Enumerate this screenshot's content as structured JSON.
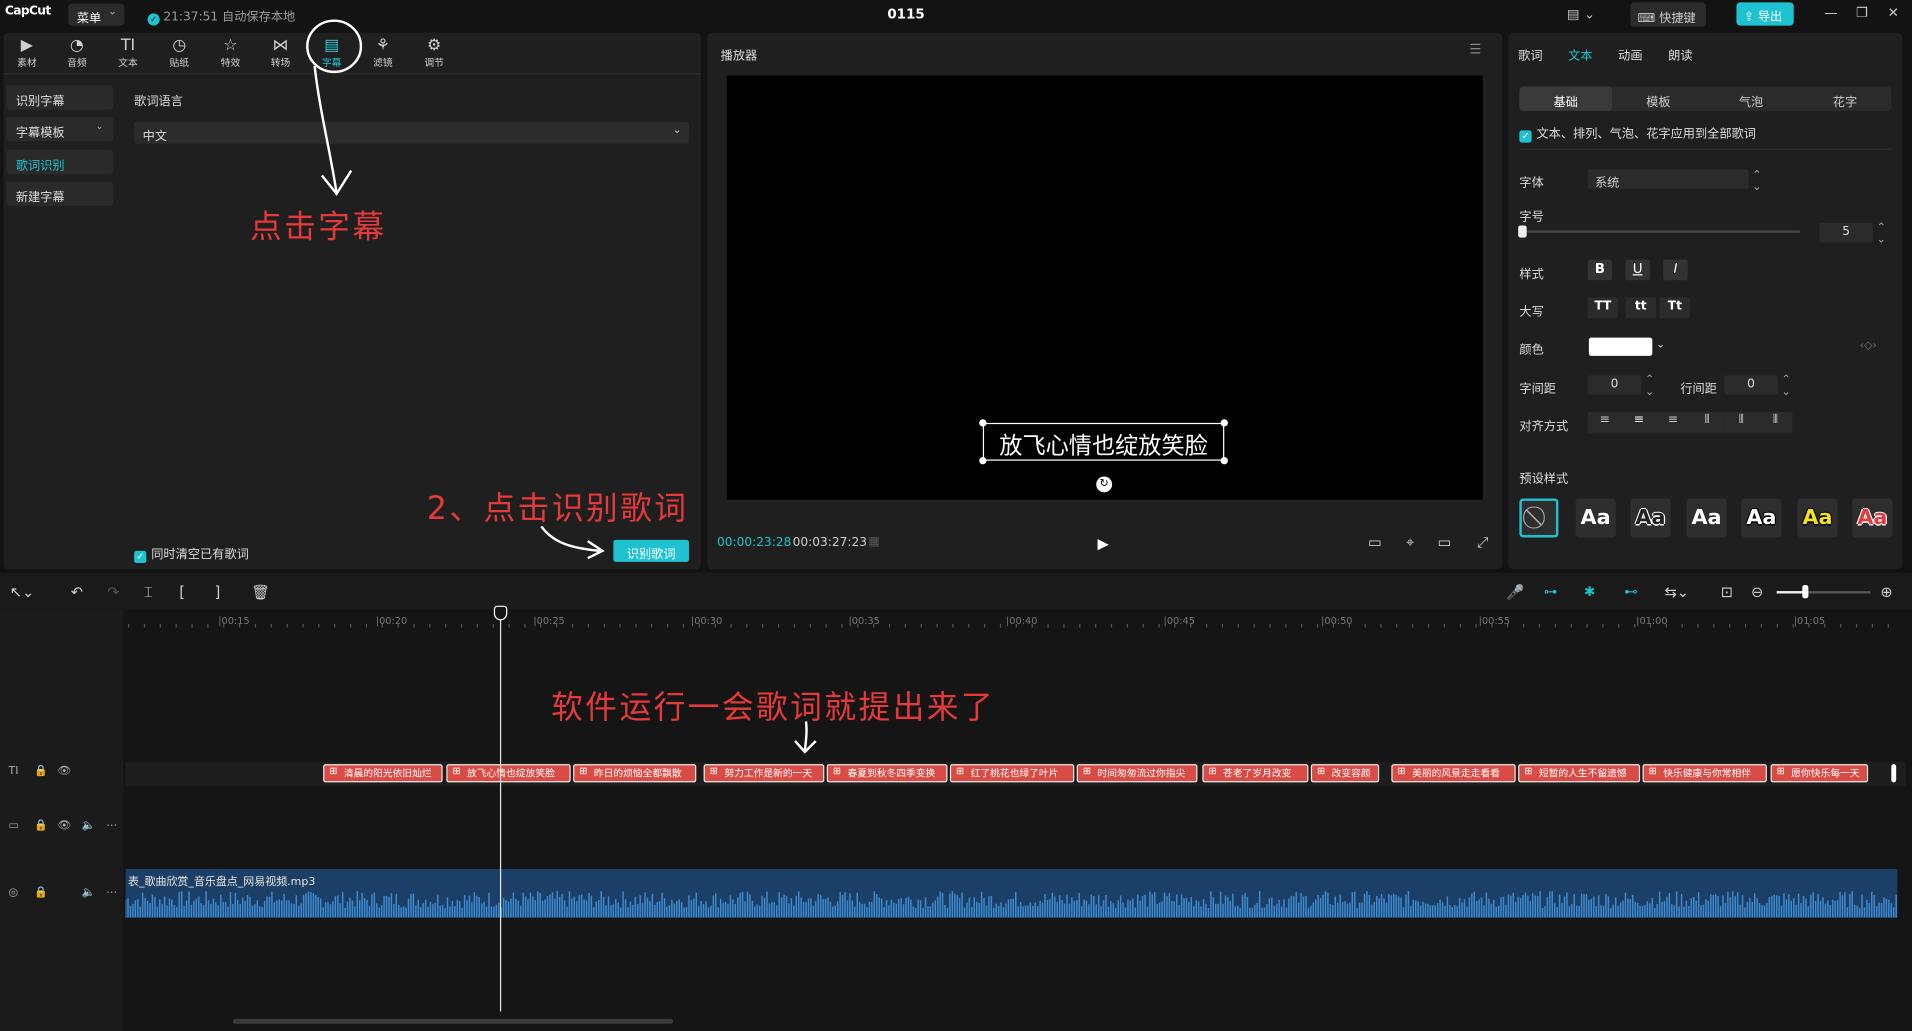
{
  "app": {
    "logo": "CapCut",
    "menu_label": "菜单",
    "save_status": "21:37:51 自动保存本地",
    "project_title": "0115",
    "shortcut_label": "快捷键",
    "export_label": "导出"
  },
  "media_tools": [
    {
      "label": "素材",
      "icon": "media-icon"
    },
    {
      "label": "音频",
      "icon": "audio-icon"
    },
    {
      "label": "文本",
      "icon": "text-icon"
    },
    {
      "label": "贴纸",
      "icon": "sticker-icon"
    },
    {
      "label": "特效",
      "icon": "effects-icon"
    },
    {
      "label": "转场",
      "icon": "transition-icon"
    },
    {
      "label": "字幕",
      "icon": "captions-icon",
      "active": true
    },
    {
      "label": "滤镜",
      "icon": "filter-icon"
    },
    {
      "label": "调节",
      "icon": "adjust-icon"
    }
  ],
  "caption_nav": [
    {
      "label": "识别字幕"
    },
    {
      "label": "字幕模板"
    },
    {
      "label": "歌词识别",
      "active": true
    },
    {
      "label": "新建字幕"
    }
  ],
  "lyrics_panel": {
    "language_label": "歌词语言",
    "language_value": "中文",
    "clear_existing_label": "同时清空已有歌词",
    "recognize_button": "识别歌词"
  },
  "player": {
    "title": "播放器",
    "caption_text": "放飞心情也绽放笑脸",
    "current_time": "00:00:23:28",
    "total_time": "00:03:27:23"
  },
  "properties": {
    "tabs": [
      {
        "label": "歌词"
      },
      {
        "label": "文本",
        "active": true
      },
      {
        "label": "动画"
      },
      {
        "label": "朗读"
      }
    ],
    "segments": [
      {
        "label": "基础",
        "active": true
      },
      {
        "label": "模板"
      },
      {
        "label": "气泡"
      },
      {
        "label": "花字"
      }
    ],
    "apply_all_label": "文本、排列、气泡、花字应用到全部歌词",
    "font_label": "字体",
    "font_value": "系统",
    "size_label": "字号",
    "size_value": "5",
    "style_label": "样式",
    "case_label": "大写",
    "case_buttons": [
      "TT",
      "tt",
      "Tt"
    ],
    "color_label": "颜色",
    "color_value": "#ffffff",
    "char_spacing_label": "字间距",
    "char_spacing_value": "0",
    "line_spacing_label": "行间距",
    "line_spacing_value": "0",
    "align_label": "对齐方式",
    "preset_label": "预设样式",
    "preset_text": "Aa",
    "presets": [
      {
        "color": "#ffffff",
        "outline": "none"
      },
      {
        "color": "#222222",
        "outline": "#ffffff"
      },
      {
        "color": "#ffffff",
        "outline": "none"
      },
      {
        "color": "#ffffff",
        "outline": "#000000"
      },
      {
        "color": "#f5e11a",
        "outline": "#000000"
      },
      {
        "color": "#e23b3b",
        "outline": "#ffffff"
      }
    ]
  },
  "timeline": {
    "ruler_labels": [
      "00:15",
      "00:20",
      "00:25",
      "00:30",
      "00:35",
      "00:40",
      "00:45",
      "00:50",
      "00:55",
      "01:00",
      "01:05"
    ],
    "lyric_clips": [
      "清晨的阳光依旧灿烂",
      "放飞心情也绽放笑脸",
      "昨日的烦恼全都飘散",
      "努力工作是新的一天",
      "春夏到秋冬四季变换",
      "红了桃花也绿了叶片",
      "时间匆匆流过你指尖",
      "苍老了岁月改变",
      "改变容颜",
      "美丽的风景走走看看",
      "短暂的人生不留遗憾",
      "快乐健康与你常相伴",
      "愿你快乐每一天"
    ],
    "audio_name": "表_歌曲欣赏_音乐盘点_网易视频.mp3"
  },
  "annotations": {
    "click_captions": "点击字幕",
    "click_recognize": "2、点击识别歌词",
    "lyrics_appear": "软件运行一会歌词就提出来了"
  }
}
